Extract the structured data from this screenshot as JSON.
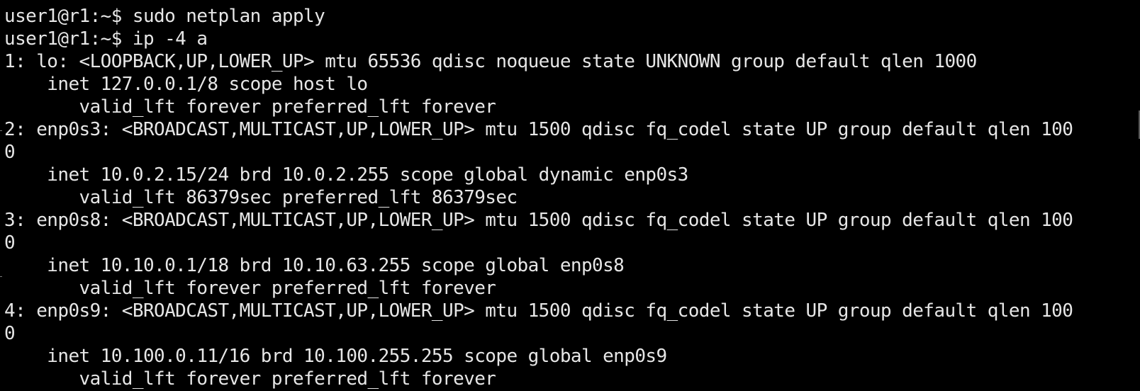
{
  "terminal": {
    "lines": [
      "user1@r1:~$ sudo netplan apply",
      "user1@r1:~$ ip -4 a",
      "1: lo: <LOOPBACK,UP,LOWER_UP> mtu 65536 qdisc noqueue state UNKNOWN group default qlen 1000",
      "    inet 127.0.0.1/8 scope host lo",
      "       valid_lft forever preferred_lft forever",
      "2: enp0s3: <BROADCAST,MULTICAST,UP,LOWER_UP> mtu 1500 qdisc fq_codel state UP group default qlen 100",
      "0",
      "    inet 10.0.2.15/24 brd 10.0.2.255 scope global dynamic enp0s3",
      "       valid_lft 86379sec preferred_lft 86379sec",
      "3: enp0s8: <BROADCAST,MULTICAST,UP,LOWER_UP> mtu 1500 qdisc fq_codel state UP group default qlen 100",
      "0",
      "    inet 10.10.0.1/18 brd 10.10.63.255 scope global enp0s8",
      "       valid_lft forever preferred_lft forever",
      "4: enp0s9: <BROADCAST,MULTICAST,UP,LOWER_UP> mtu 1500 qdisc fq_codel state UP group default qlen 100",
      "0",
      "    inet 10.100.0.11/16 brd 10.100.255.255 scope global enp0s9",
      "       valid_lft forever preferred_lft forever"
    ],
    "colors": {
      "background": "#000000",
      "foreground": "#e6e6e6"
    }
  }
}
